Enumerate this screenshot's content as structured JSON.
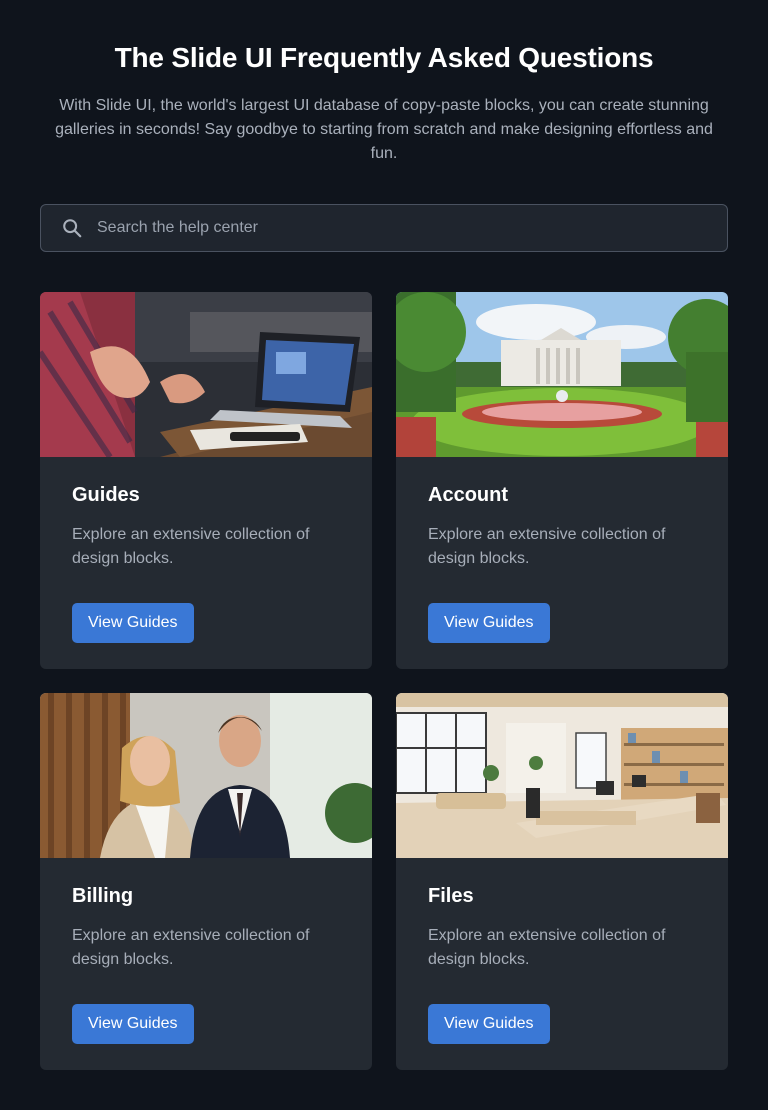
{
  "header": {
    "title": "The Slide UI Frequently Asked Questions",
    "subtitle": "With Slide UI, the world's largest UI database of copy-paste blocks, you can create stunning galleries in seconds! Say goodbye to starting from scratch and make designing effortless and fun."
  },
  "search": {
    "placeholder": "Search the help center",
    "icon": "search-icon"
  },
  "cards": [
    {
      "title": "Guides",
      "description": "Explore an extensive collection of design blocks.",
      "button_label": "View Guides",
      "image": "meeting-laptop-photo"
    },
    {
      "title": "Account",
      "description": "Explore an extensive collection of design blocks.",
      "button_label": "View Guides",
      "image": "white-house-garden-photo"
    },
    {
      "title": "Billing",
      "description": "Explore an extensive collection of design blocks.",
      "button_label": "View Guides",
      "image": "business-people-photo"
    },
    {
      "title": "Files",
      "description": "Explore an extensive collection of design blocks.",
      "button_label": "View Guides",
      "image": "office-interior-photo"
    }
  ],
  "colors": {
    "background": "#0f141c",
    "card": "#242a32",
    "accent": "#3a78d6"
  }
}
